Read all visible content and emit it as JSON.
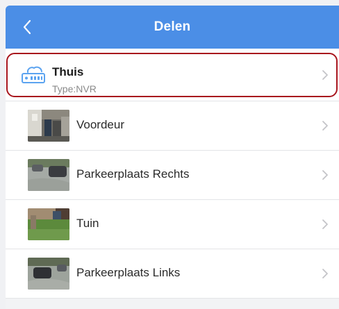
{
  "header": {
    "title": "Delen"
  },
  "device": {
    "name": "Thuis",
    "type": "Type:NVR",
    "icon": "nvr-recorder-icon"
  },
  "cameras": [
    {
      "name": "Voordeur"
    },
    {
      "name": "Parkeerplaats Rechts"
    },
    {
      "name": "Tuin"
    },
    {
      "name": "Parkeerplaats Links"
    }
  ],
  "colors": {
    "header": "#4b8ee6",
    "highlight": "#a8151d",
    "icon": "#5ba3f0"
  }
}
